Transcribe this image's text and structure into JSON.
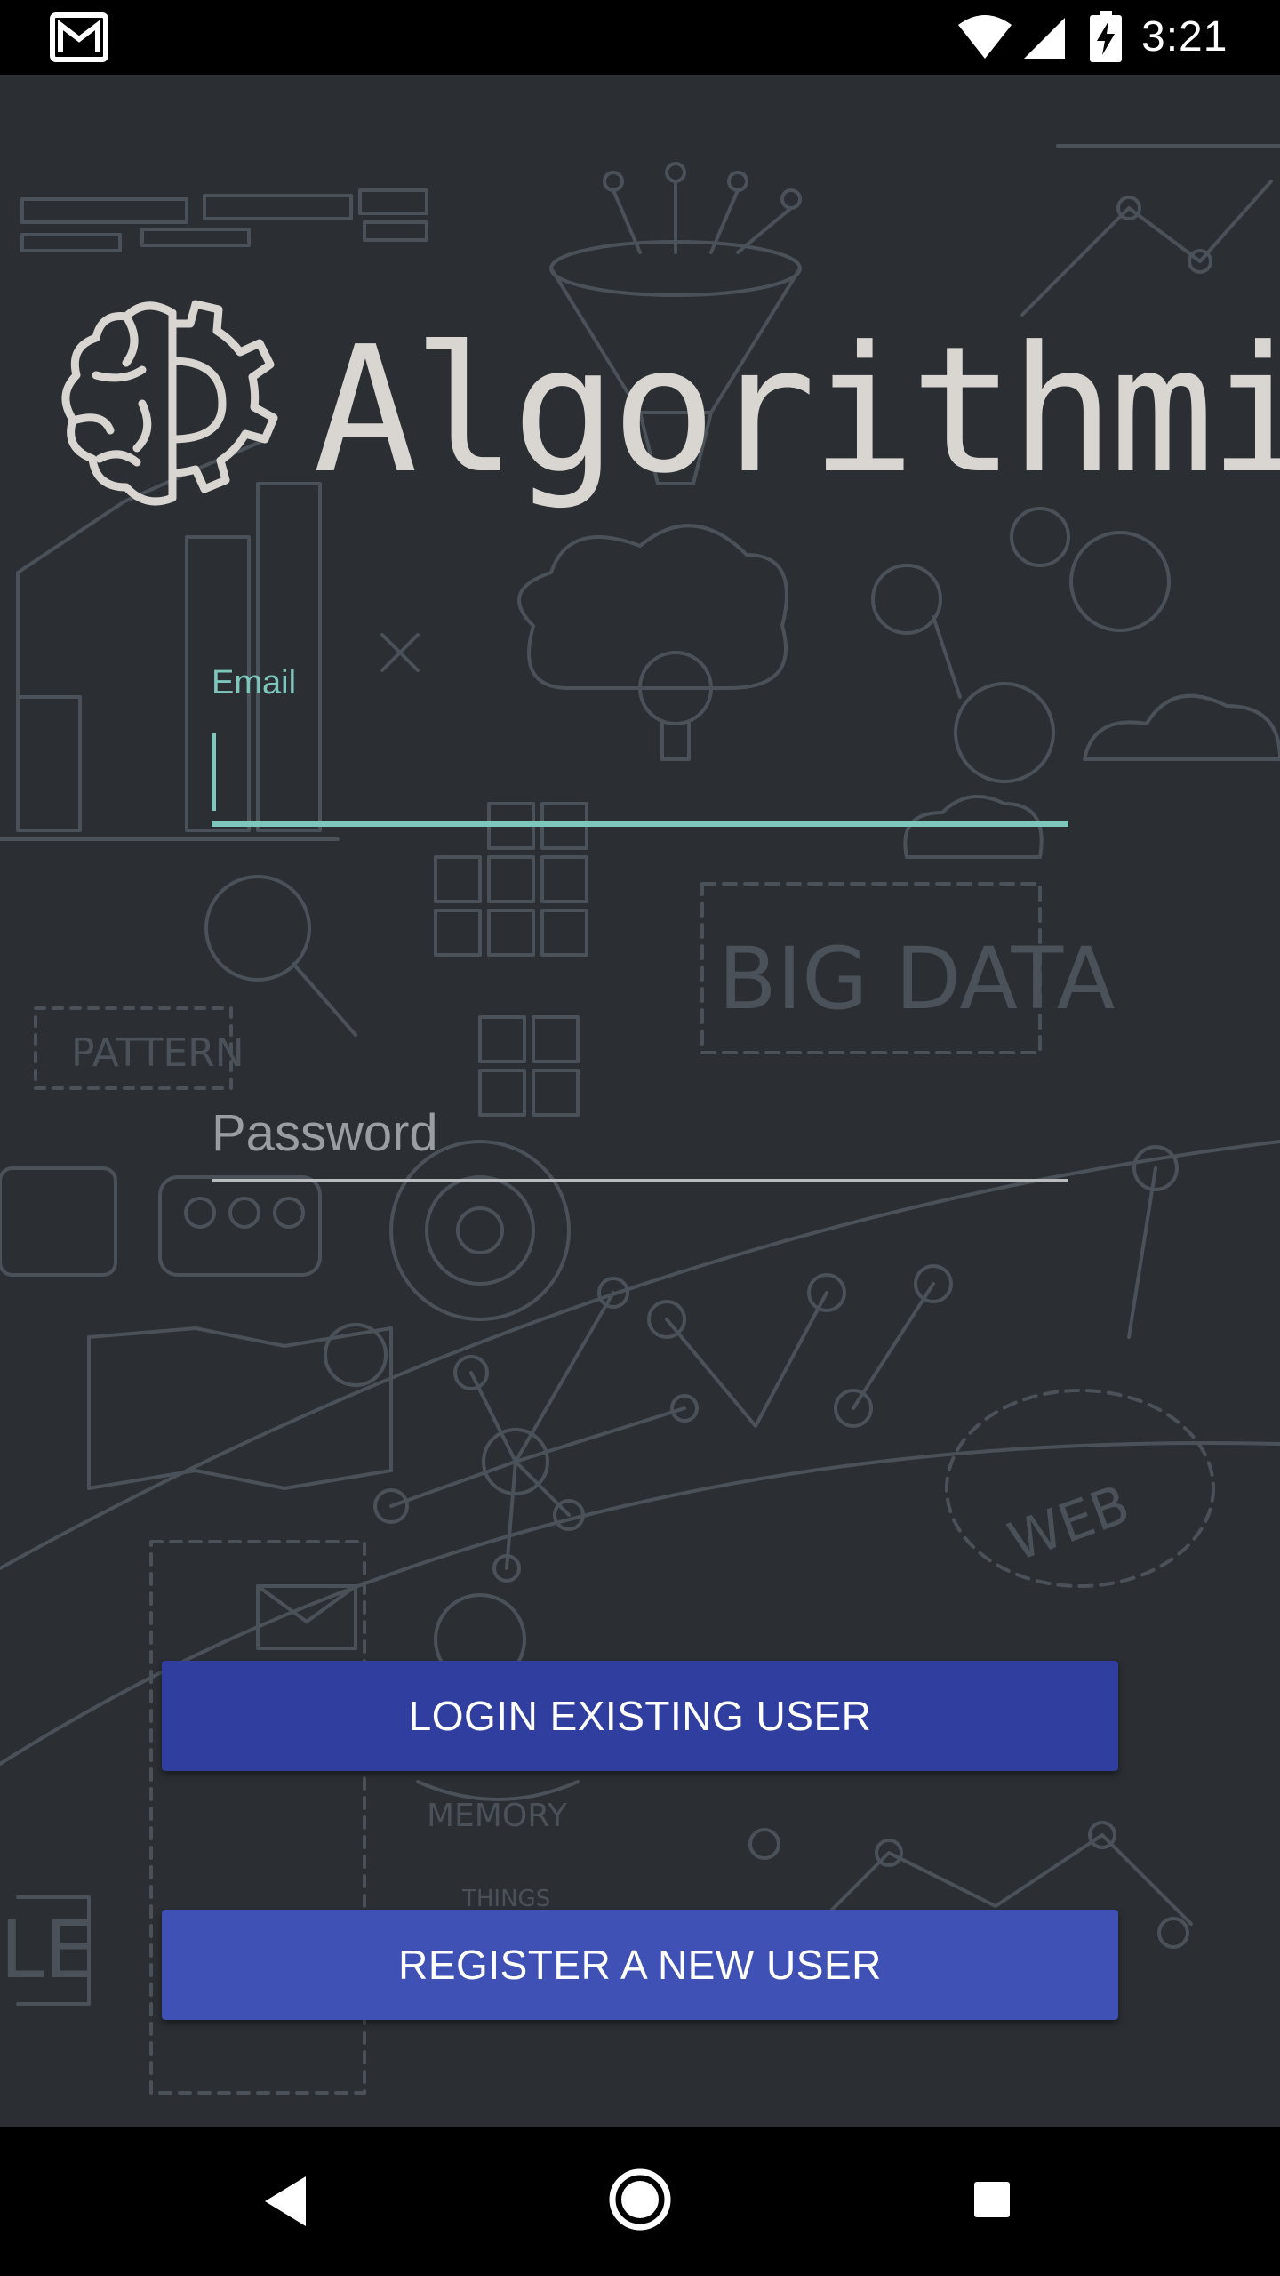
{
  "status_bar": {
    "time": "3:21",
    "icons": [
      "gmail-icon",
      "wifi-icon",
      "cell-signal-icon",
      "battery-charging-icon"
    ]
  },
  "app": {
    "logo_text": "Algorithmic",
    "background_color": "#2b2f33"
  },
  "form": {
    "email_label": "Email",
    "email_value": "",
    "password_placeholder": "Password",
    "password_value": "",
    "accent_color": "#7fc7bd"
  },
  "buttons": {
    "login_label": "LOGIN EXISTING USER",
    "register_label": "REGISTER A NEW USER",
    "login_color": "#303f9f",
    "register_color": "#3f51b5"
  },
  "doodle_text": {
    "big_data": "BIG DATA",
    "pattern": "PATTERN",
    "web": "WEB",
    "memory": "MEMORY",
    "things": "THINGS",
    "le": "LE"
  },
  "nav_bar": {
    "icons": [
      "back-icon",
      "home-icon",
      "recents-icon"
    ]
  }
}
